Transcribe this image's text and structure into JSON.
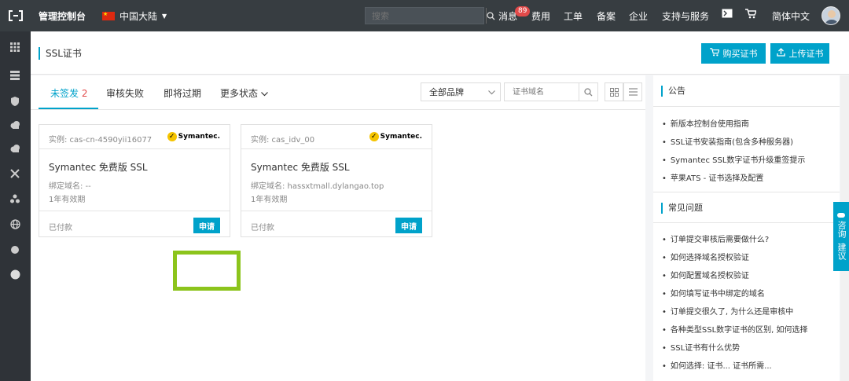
{
  "topbar": {
    "title": "管理控制台",
    "region": "中国大陆",
    "search_placeholder": "搜索",
    "nav": [
      {
        "label": "消息"
      },
      {
        "label": "费用"
      },
      {
        "label": "工单"
      },
      {
        "label": "备案"
      },
      {
        "label": "企业"
      },
      {
        "label": "支持与服务"
      },
      {
        "label": "简体中文"
      }
    ],
    "message_badge": "89"
  },
  "header": {
    "title": "SSL证书",
    "buy_label": "购买证书",
    "upload_label": "上传证书"
  },
  "tabs": [
    {
      "label": "未签发",
      "count": "2",
      "active": true
    },
    {
      "label": "审核失败"
    },
    {
      "label": "即将过期"
    },
    {
      "label": "更多状态"
    }
  ],
  "filters": {
    "brand_select": "全部品牌",
    "domain_placeholder": "证书域名"
  },
  "cards": [
    {
      "instance": "实例: cas-cn-4590yii16077",
      "brand": "Symantec.",
      "name": "Symantec 免费版 SSL",
      "domain": "绑定域名: --",
      "validity": "1年有效期",
      "status": "已付款",
      "apply_label": "申请"
    },
    {
      "instance": "实例: cas_idv_00",
      "brand": "Symantec.",
      "name": "Symantec 免费版 SSL",
      "domain": "绑定域名: hassxtmall.dylangao.top",
      "validity": "1年有效期",
      "status": "已付款",
      "apply_label": "申请"
    }
  ],
  "announcements": {
    "title": "公告",
    "items": [
      "新版本控制台使用指南",
      "SSL证书安装指南(包含多种服务器)",
      "Symantec SSL数字证书升级重签提示",
      "苹果ATS - 证书选择及配置"
    ]
  },
  "faq": {
    "title": "常见问题",
    "items": [
      "订单提交审核后需要做什么?",
      "如何选择域名授权验证",
      "如何配置域名授权验证",
      "如何填写证书中绑定的域名",
      "订单提交很久了, 为什么还是审核中",
      "各种类型SSL数字证书的区别, 如何选择",
      "SSL证书有什么优势",
      "如何选择: 证书... 证书所需..."
    ]
  },
  "floating": {
    "label1": "咨询",
    "label2": "建议"
  },
  "colors": {
    "accent": "#00a2ca",
    "topbar": "#373d41",
    "sidebar": "#2f3338",
    "highlight": "#8cc41c",
    "badge": "#e24a4a"
  }
}
